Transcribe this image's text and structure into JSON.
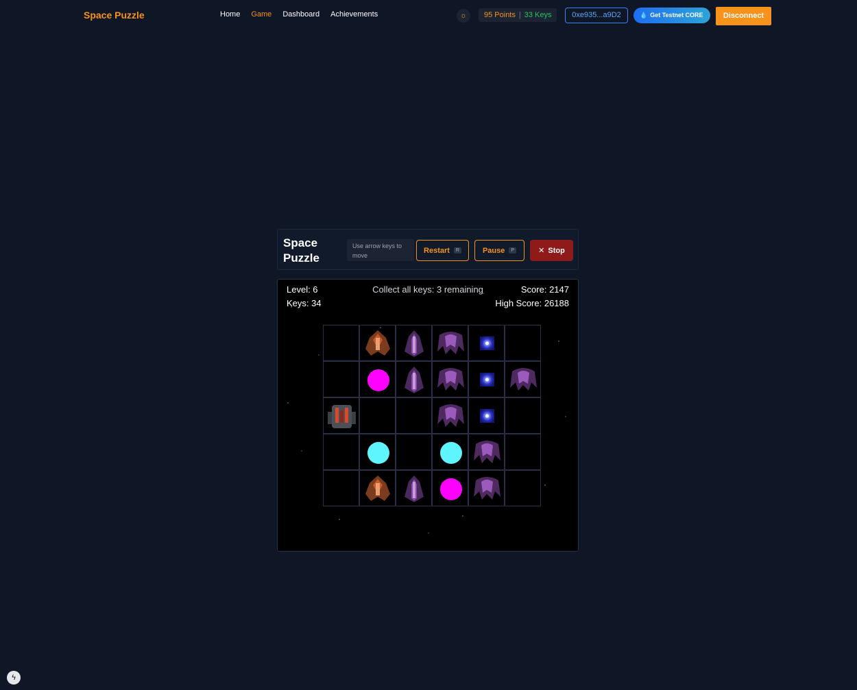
{
  "nav": {
    "brand": "Space Puzzle",
    "links": [
      "Home",
      "Game",
      "Dashboard",
      "Achievements"
    ],
    "active": "Game",
    "points": "95 Points",
    "keys": "33 Keys",
    "address": "0xe935...a9D2",
    "faucet": "Get Testnet CORE",
    "disconnect": "Disconnect"
  },
  "game": {
    "title": "Space Puzzle",
    "hint": "Use arrow keys to move",
    "restart": "Restart",
    "restart_key": "R",
    "pause": "Pause",
    "pause_key": "P",
    "stop": "Stop"
  },
  "hud": {
    "level": "Level: 6",
    "keys": "Keys: 34",
    "collect": "Collect all keys: 3 remaining",
    "score": "Score: 2147",
    "high_score": "High Score: 26188"
  },
  "board": {
    "cols": 6,
    "rows": 5,
    "cells": [
      [
        "empty",
        "red-ship",
        "purple-fighter",
        "purple-crab",
        "key",
        "empty"
      ],
      [
        "empty",
        "magenta-orb",
        "purple-fighter",
        "purple-crab",
        "key",
        "purple-crab"
      ],
      [
        "player-ship",
        "empty",
        "empty",
        "purple-crab",
        "key",
        "empty"
      ],
      [
        "empty",
        "cyan-orb",
        "empty",
        "cyan-orb",
        "purple-crab",
        "empty"
      ],
      [
        "empty",
        "red-ship",
        "purple-fighter",
        "magenta-orb",
        "purple-crab",
        "empty"
      ]
    ]
  },
  "colors": {
    "accent": "#f7931a",
    "magenta": "#ff00ff",
    "cyan": "#5ff5ff",
    "stop": "#8f1a1a"
  }
}
